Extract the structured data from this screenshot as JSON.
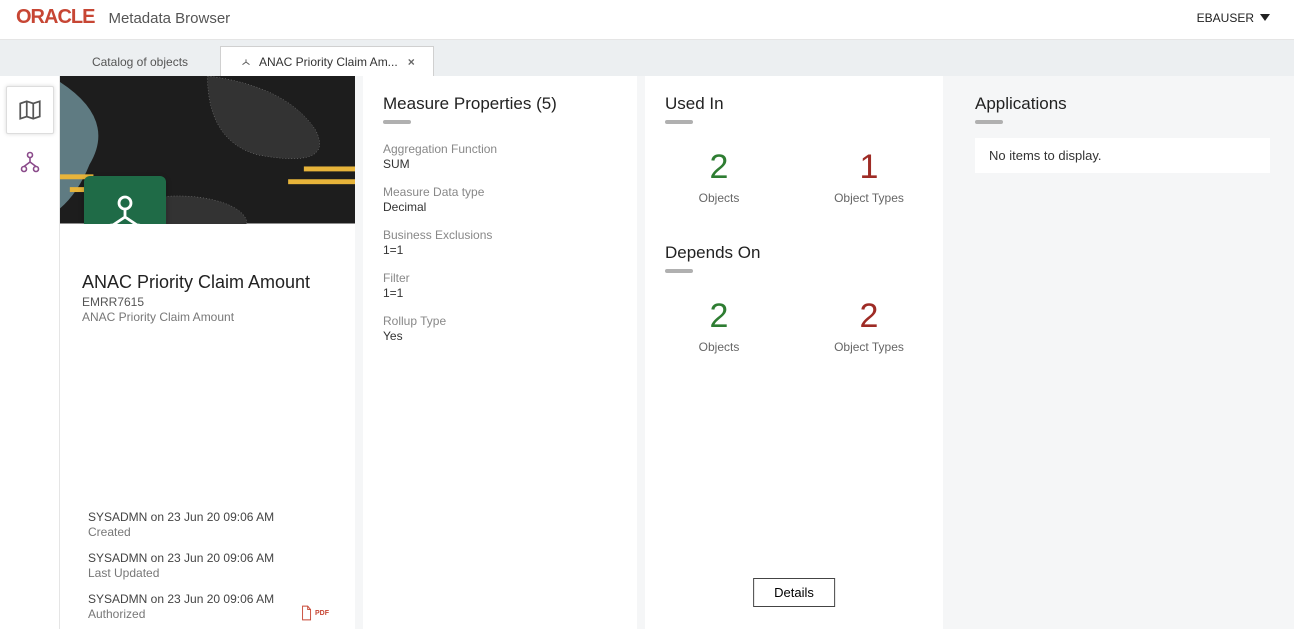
{
  "header": {
    "logo_text": "ORACLE",
    "app_title": "Metadata Browser",
    "user": "EBAUSER"
  },
  "tabs": {
    "catalog_label": "Catalog of objects",
    "active_label": "ANAC Priority Claim Am..."
  },
  "object": {
    "title": "ANAC Priority Claim Amount",
    "code": "EMRR7615",
    "description": "ANAC Priority Claim Amount"
  },
  "audit": {
    "created_line": "SYSADMN on 23 Jun 20 09:06 AM",
    "created_label": "Created",
    "updated_line": "SYSADMN on 23 Jun 20 09:06 AM",
    "updated_label": "Last Updated",
    "auth_line": "SYSADMN on 23 Jun 20 09:06 AM",
    "auth_label": "Authorized"
  },
  "properties": {
    "heading": "Measure Properties (5)",
    "items": {
      "agg_k": "Aggregation Function",
      "agg_v": "SUM",
      "dtype_k": "Measure Data type",
      "dtype_v": "Decimal",
      "excl_k": "Business Exclusions",
      "excl_v": "1=1",
      "filter_k": "Filter",
      "filter_v": "1=1",
      "rollup_k": "Rollup Type",
      "rollup_v": "Yes"
    }
  },
  "relations": {
    "usedin_heading": "Used In",
    "usedin_objects": "2",
    "usedin_types": "1",
    "dependson_heading": "Depends On",
    "dependson_objects": "2",
    "dependson_types": "2",
    "objects_label": "Objects",
    "types_label": "Object Types",
    "details_label": "Details"
  },
  "applications": {
    "heading": "Applications",
    "empty_text": "No items to display."
  },
  "pdf_label": "PDF"
}
